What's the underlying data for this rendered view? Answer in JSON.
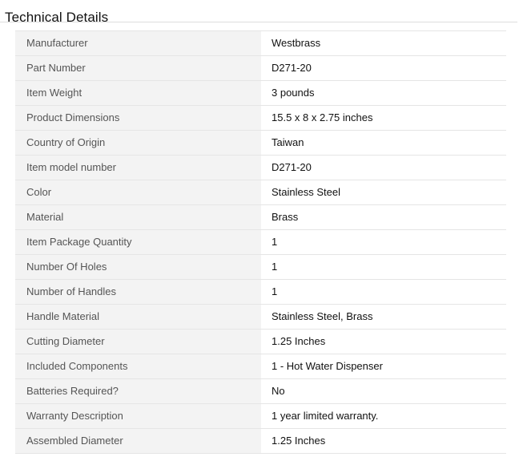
{
  "section": {
    "title": "Technical Details"
  },
  "rows": [
    {
      "label": "Manufacturer",
      "value": "Westbrass"
    },
    {
      "label": "Part Number",
      "value": "D271-20"
    },
    {
      "label": "Item Weight",
      "value": "3 pounds"
    },
    {
      "label": "Product Dimensions",
      "value": "15.5 x 8 x 2.75 inches"
    },
    {
      "label": "Country of Origin",
      "value": "Taiwan"
    },
    {
      "label": "Item model number",
      "value": "D271-20"
    },
    {
      "label": "Color",
      "value": "Stainless Steel"
    },
    {
      "label": "Material",
      "value": "Brass"
    },
    {
      "label": "Item Package Quantity",
      "value": "1"
    },
    {
      "label": "Number Of Holes",
      "value": "1"
    },
    {
      "label": "Number of Handles",
      "value": "1"
    },
    {
      "label": "Handle Material",
      "value": "Stainless Steel, Brass"
    },
    {
      "label": "Cutting Diameter",
      "value": "1.25 Inches"
    },
    {
      "label": "Included Components",
      "value": "1 - Hot Water Dispenser"
    },
    {
      "label": "Batteries Required?",
      "value": "No"
    },
    {
      "label": "Warranty Description",
      "value": "1 year limited warranty."
    },
    {
      "label": "Assembled Diameter",
      "value": "1.25 Inches"
    }
  ]
}
